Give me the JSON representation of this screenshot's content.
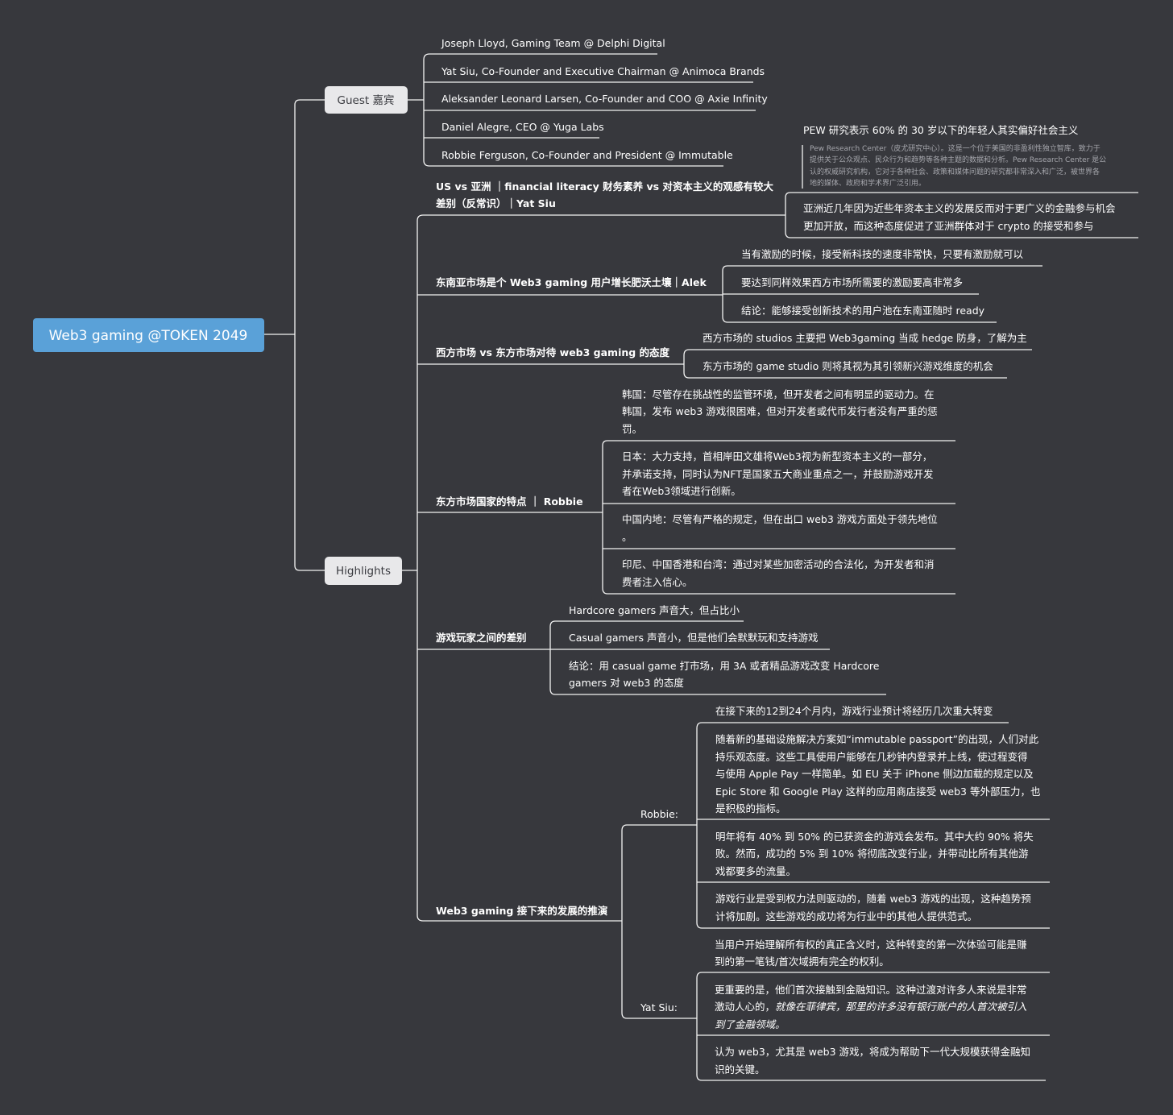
{
  "root": {
    "label": "Web3 gaming @TOKEN 2049"
  },
  "guest": {
    "label": "Guest 嘉宾",
    "items": [
      "Joseph Lloyd, Gaming Team @ Delphi Digital",
      "Yat Siu, Co-Founder and Executive Chairman @ Animoca Brands",
      "Aleksander Leonard Larsen, Co-Founder and COO @ Axie Infinity",
      "Daniel Alegre, CEO @ Yuga Labs",
      "Robbie Ferguson, Co-Founder and President @ Immutable"
    ]
  },
  "highlights": {
    "label": "Highlights",
    "topic1": {
      "title": [
        "US vs 亚洲 ｜financial literacy 财务素养 vs 对资本主义的观感有较大",
        "差别（反常识）｜Yat Siu"
      ],
      "pew_title": "PEW 研究表示 60% 的 30 岁以下的年轻人其实偏好社会主义",
      "pew_note": [
        "Pew Research Center（皮尤研究中心）。这是一个位于美国的非盈利性独立智库，致力于",
        "提供关于公众观点、民众行为和趋势等各种主题的数据和分析。Pew Research Center 是公",
        "认的权威研究机构，它对于各种社会、政策和媒体问题的研究都非常深入和广泛，被世界各",
        "地的媒体、政府和学术界广泛引用。"
      ],
      "asia": [
        "亚洲近几年因为近些年资本主义的发展反而对于更广义的金融参与机会",
        "更加开放，而这种态度促进了亚洲群体对于 crypto 的接受和参与"
      ]
    },
    "topic2": {
      "title": "东南亚市场是个 Web3 gaming 用户增长肥沃土壤｜Alek",
      "items": [
        "当有激励的时候，接受新科技的速度非常快，只要有激励就可以",
        "要达到同样效果西方市场所需要的激励要高非常多",
        "结论：能够接受创新技术的用户池在东南亚随时 ready"
      ]
    },
    "topic3": {
      "title": "西方市场 vs 东方市场对待 web3 gaming 的态度",
      "items": [
        "西方市场的 studios 主要把 Web3gaming 当成 hedge 防身，了解为主",
        "东方市场的 game studio 则将其视为其引领新兴游戏维度的机会"
      ]
    },
    "topic4": {
      "title": "东方市场国家的特点 ｜ Robbie",
      "korea": [
        "韩国：尽管存在挑战性的监管环境，但开发者之间有明显的驱动力。在",
        "韩国，发布 web3 游戏很困难，但对开发者或代币发行者没有严重的惩",
        "罚。"
      ],
      "japan": [
        "日本：大力支持，首相岸田文雄将Web3视为新型资本主义的一部分，",
        "并承诺支持，同时认为NFT是国家五大商业重点之一，并鼓励游戏开发",
        "者在Web3领域进行创新。"
      ],
      "china": [
        "中国内地：尽管有严格的规定，但在出口 web3 游戏方面处于领先地位",
        "。"
      ],
      "others": [
        "印尼、中国香港和台湾：通过对某些加密活动的合法化，为开发者和消",
        "费者注入信心。"
      ]
    },
    "topic5": {
      "title": "游戏玩家之间的差别",
      "hardcore": "Hardcore gamers 声音大，但占比小",
      "casual": "Casual gamers 声音小，但是他们会默默玩和支持游戏",
      "conclusion": [
        "结论：用 casual game 打市场，用 3A 或者精品游戏改变 Hardcore",
        "gamers 对 web3 的态度"
      ]
    },
    "topic6": {
      "title": "Web3 gaming 接下来的发展的推演",
      "robbie": {
        "label": "Robbie:",
        "p1": "在接下来的12到24个月内，游戏行业预计将经历几次重大转变",
        "p2": [
          "随着新的基础设施解决方案如“immutable passport”的出现，人们对此",
          "持乐观态度。这些工具使用户能够在几秒钟内登录并上线，使过程变得",
          "与使用 Apple Pay 一样简单。如 EU 关于 iPhone 侧边加载的规定以及",
          "Epic Store 和 Google Play 这样的应用商店接受 web3 等外部压力，也",
          "是积极的指标。"
        ],
        "p3": [
          "明年将有 40% 到 50% 的已获资金的游戏会发布。其中大约 90% 将失",
          "败。然而，成功的 5% 到 10% 将彻底改变行业，并带动比所有其他游",
          "戏都要多的流量。"
        ],
        "p4": [
          "游戏行业是受到权力法则驱动的，随着 web3 游戏的出现，这种趋势预",
          "计将加剧。这些游戏的成功将为行业中的其他人提供范式。"
        ]
      },
      "yat": {
        "label": "Yat Siu:",
        "p1": [
          "当用户开始理解所有权的真正含义时，这种转变的第一次体验可能是赚",
          "到的第一笔钱/首次域拥有完全的权利。"
        ],
        "p2_line1": "更重要的是，他们首次接触到金融知识。这种过渡对许多人来说是非常",
        "p2_line2_normal": "激动人心的，",
        "p2_line2_italic": "就像在菲律宾，那里的许多没有银行账户的人首次被引入",
        "p2_line3_italic": "到了金融领域。",
        "p3": [
          "认为 web3，尤其是 web3 游戏，将成为帮助下一代大规模获得金融知",
          "识的关键。"
        ]
      }
    }
  }
}
